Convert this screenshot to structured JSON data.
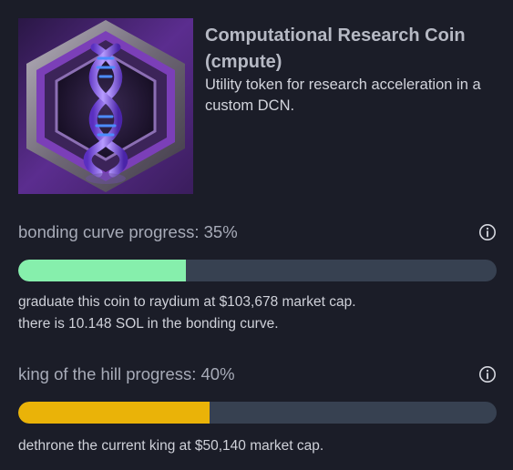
{
  "coin": {
    "image_icon": "dna-helix-hexagon-icon",
    "name": "Computational Research Coin (cmpute)",
    "description": "Utility token for research acceleration in a custom DCN."
  },
  "bonding_curve": {
    "title": "bonding curve progress: 35%",
    "progress_fraction": 0.35,
    "bar_color": "#86efac",
    "info_icon": "info-icon",
    "note_line1": "graduate this coin to raydium at $103,678 market cap.",
    "note_line2": "there is 10.148 SOL in the bonding curve."
  },
  "king_of_the_hill": {
    "title": "king of the hill progress: 40%",
    "progress_fraction": 0.4,
    "bar_color": "#eab308",
    "info_icon": "info-icon",
    "note": "dethrone the current king at $50,140 market cap."
  },
  "colors": {
    "background": "#1b1d28",
    "track": "#374151"
  }
}
